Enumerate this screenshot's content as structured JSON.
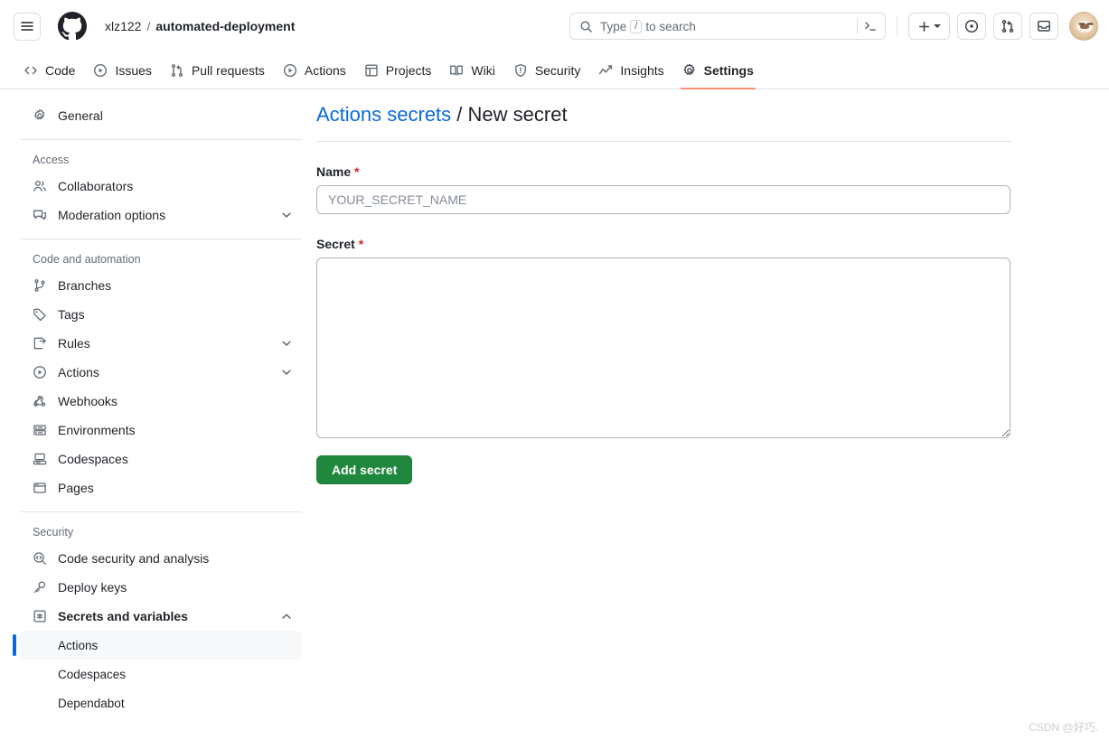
{
  "header": {
    "menu_icon": "hamburger-icon",
    "logo_icon": "github-logo-icon",
    "repo_owner": "xlz122",
    "repo_separator": "/",
    "repo_name": "automated-deployment",
    "search": {
      "icon": "search-icon",
      "placeholder_prefix": "Type",
      "placeholder_key": "/",
      "placeholder_suffix": "to search",
      "terminal_icon": "command-palette-icon"
    },
    "actions": [
      {
        "name": "create-new-button",
        "icon": "plus-icon"
      },
      {
        "name": "issues-global-button",
        "icon": "issue-opened-icon"
      },
      {
        "name": "pull-requests-global-button",
        "icon": "git-pull-request-icon"
      },
      {
        "name": "inbox-button",
        "icon": "inbox-icon"
      },
      {
        "name": "user-avatar",
        "icon": "avatar-icon"
      }
    ]
  },
  "repo_nav": {
    "tabs": [
      {
        "label": "Code",
        "icon": "code-icon",
        "active": false
      },
      {
        "label": "Issues",
        "icon": "issue-opened-icon",
        "active": false
      },
      {
        "label": "Pull requests",
        "icon": "git-pull-request-icon",
        "active": false
      },
      {
        "label": "Actions",
        "icon": "play-icon",
        "active": false
      },
      {
        "label": "Projects",
        "icon": "table-icon",
        "active": false
      },
      {
        "label": "Wiki",
        "icon": "book-icon",
        "active": false
      },
      {
        "label": "Security",
        "icon": "shield-icon",
        "active": false
      },
      {
        "label": "Insights",
        "icon": "graph-icon",
        "active": false
      },
      {
        "label": "Settings",
        "icon": "gear-icon",
        "active": true
      }
    ],
    "active_underline_color": "#fd8c73"
  },
  "sidebar": {
    "groups": [
      {
        "title": null,
        "divider_after": true,
        "items": [
          {
            "label": "General",
            "icon": "gear-icon",
            "chevron": null,
            "active": false,
            "sub": false
          }
        ]
      },
      {
        "title": "Access",
        "divider_after": true,
        "items": [
          {
            "label": "Collaborators",
            "icon": "people-icon",
            "chevron": null,
            "active": false,
            "sub": false
          },
          {
            "label": "Moderation options",
            "icon": "comment-discussion-icon",
            "chevron": "chevron-down-icon",
            "active": false,
            "sub": false
          }
        ]
      },
      {
        "title": "Code and automation",
        "divider_after": true,
        "items": [
          {
            "label": "Branches",
            "icon": "git-branch-icon",
            "chevron": null,
            "active": false,
            "sub": false
          },
          {
            "label": "Tags",
            "icon": "tag-icon",
            "chevron": null,
            "active": false,
            "sub": false
          },
          {
            "label": "Rules",
            "icon": "rule-icon",
            "chevron": "chevron-down-icon",
            "active": false,
            "sub": false
          },
          {
            "label": "Actions",
            "icon": "play-icon",
            "chevron": "chevron-down-icon",
            "active": false,
            "sub": false
          },
          {
            "label": "Webhooks",
            "icon": "webhook-icon",
            "chevron": null,
            "active": false,
            "sub": false
          },
          {
            "label": "Environments",
            "icon": "server-icon",
            "chevron": null,
            "active": false,
            "sub": false
          },
          {
            "label": "Codespaces",
            "icon": "codespaces-icon",
            "chevron": null,
            "active": false,
            "sub": false
          },
          {
            "label": "Pages",
            "icon": "browser-icon",
            "chevron": null,
            "active": false,
            "sub": false
          }
        ]
      },
      {
        "title": "Security",
        "divider_after": false,
        "items": [
          {
            "label": "Code security and analysis",
            "icon": "code-scan-icon",
            "chevron": null,
            "active": false,
            "sub": false
          },
          {
            "label": "Deploy keys",
            "icon": "key-icon",
            "chevron": null,
            "active": false,
            "sub": false
          },
          {
            "label": "Secrets and variables",
            "icon": "asterisk-box-icon",
            "chevron": "chevron-up-icon",
            "active": false,
            "sub": false,
            "bold": true
          },
          {
            "label": "Actions",
            "icon": null,
            "chevron": null,
            "active": true,
            "sub": true
          },
          {
            "label": "Codespaces",
            "icon": null,
            "chevron": null,
            "active": false,
            "sub": true
          },
          {
            "label": "Dependabot",
            "icon": null,
            "chevron": null,
            "active": false,
            "sub": true
          }
        ]
      }
    ],
    "active_indicator_color": "#0969da"
  },
  "main": {
    "breadcrumb_link": "Actions secrets",
    "breadcrumb_separator": "/",
    "breadcrumb_current": "New secret",
    "name_label": "Name",
    "name_required": "*",
    "name_value": "",
    "name_placeholder": "YOUR_SECRET_NAME",
    "secret_label": "Secret",
    "secret_required": "*",
    "secret_value": "",
    "secret_placeholder": "",
    "submit_label": "Add secret",
    "submit_color": "#1f883d"
  },
  "watermark": "CSDN @好巧."
}
